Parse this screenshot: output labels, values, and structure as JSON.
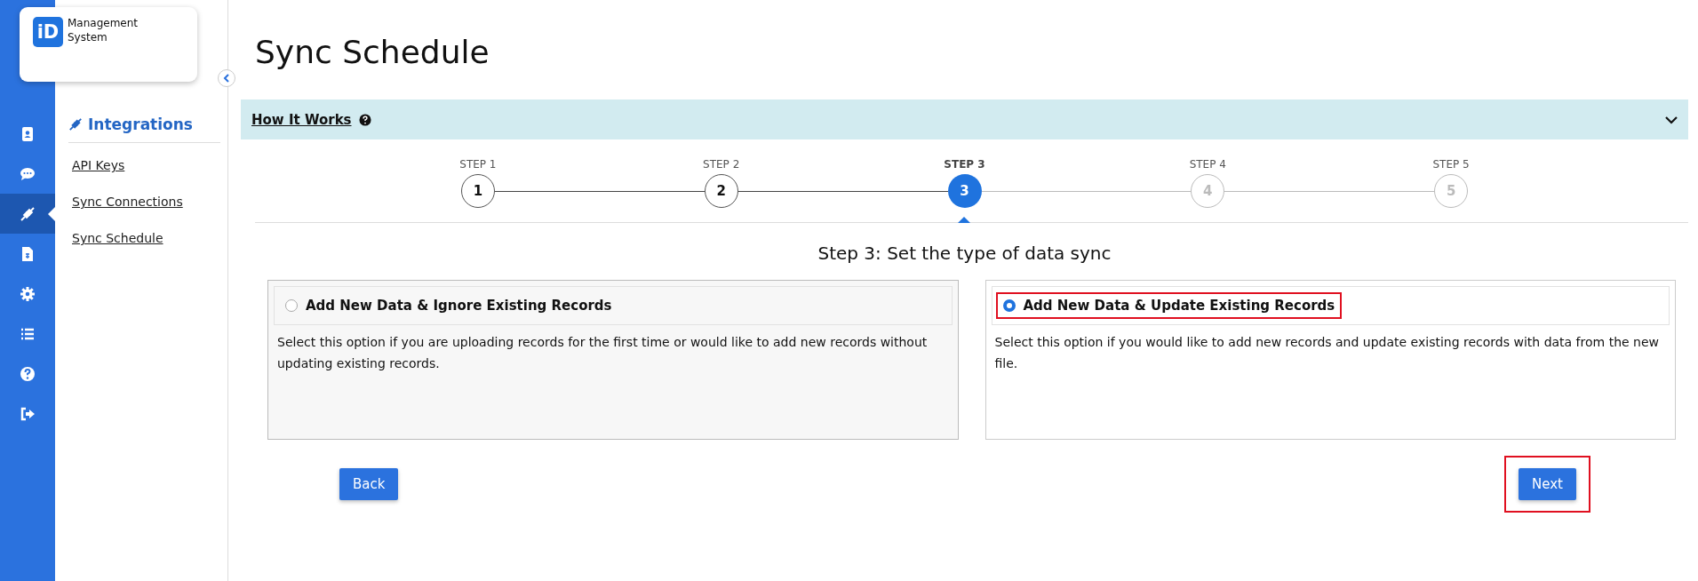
{
  "logo": {
    "mark": "iD",
    "name": "Management System"
  },
  "rail": [
    {
      "selected": false
    },
    {
      "selected": false
    },
    {
      "selected": true
    },
    {
      "selected": false
    },
    {
      "selected": false
    },
    {
      "selected": false
    },
    {
      "selected": false
    },
    {
      "selected": false
    }
  ],
  "sidebar": {
    "title": "Integrations",
    "items": [
      {
        "label": "API Keys"
      },
      {
        "label": "Sync Connections"
      },
      {
        "label": "Sync Schedule"
      }
    ]
  },
  "page_title": "Sync Schedule",
  "how_it_works": {
    "label": "How It Works",
    "expanded": false
  },
  "steps": [
    {
      "label": "STEP 1",
      "number": "1",
      "completed": true,
      "selected": false
    },
    {
      "label": "STEP 2",
      "number": "2",
      "completed": true,
      "selected": false
    },
    {
      "label": "STEP 3",
      "number": "3",
      "completed": false,
      "selected": true
    },
    {
      "label": "STEP 4",
      "number": "4",
      "completed": false,
      "selected": false
    },
    {
      "label": "STEP 5",
      "number": "5",
      "completed": false,
      "selected": false
    }
  ],
  "step_heading": "Step 3: Set the type of data sync",
  "options": [
    {
      "title": "Add New Data & Ignore Existing Records",
      "description": "Select this option if you are uploading records for the first time or would like to add new records without updating existing records.",
      "selected": false,
      "highlighted": false
    },
    {
      "title": "Add New Data & Update Existing Records",
      "description": "Select this option if you would like to add new records and update existing records with data from the new file.",
      "selected": true,
      "highlighted": true
    }
  ],
  "buttons": [
    {
      "label": "Back",
      "highlighted": false
    },
    {
      "label": "Next",
      "highlighted": true
    }
  ]
}
